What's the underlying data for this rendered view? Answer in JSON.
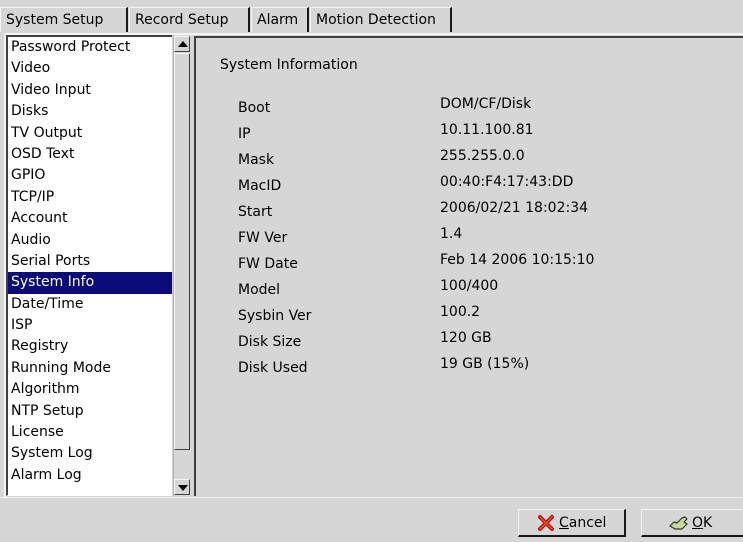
{
  "tabs": [
    {
      "label": "System Setup",
      "active": true
    },
    {
      "label": "Record Setup",
      "active": false
    },
    {
      "label": "Alarm",
      "active": false
    },
    {
      "label": "Motion Detection",
      "active": false
    }
  ],
  "sidebar": {
    "items": [
      "Password Protect",
      "Video",
      "Video Input",
      "Disks",
      "TV Output",
      "OSD Text",
      "GPIO",
      "TCP/IP",
      "Account",
      "Audio",
      "Serial Ports",
      "System Info",
      "Date/Time",
      "ISP",
      "Registry",
      "Running Mode",
      "Algorithm",
      "NTP Setup",
      "License",
      "System Log",
      "Alarm Log"
    ],
    "selected": "System Info"
  },
  "panel": {
    "title": "System Information",
    "rows": [
      {
        "label": "Boot",
        "value": "DOM/CF/Disk"
      },
      {
        "label": "IP",
        "value": "10.11.100.81"
      },
      {
        "label": "Mask",
        "value": "255.255.0.0"
      },
      {
        "label": "MacID",
        "value": "00:40:F4:17:43:DD"
      },
      {
        "label": "Start",
        "value": "2006/02/21 18:02:34"
      },
      {
        "label": "FW Ver",
        "value": "1.4"
      },
      {
        "label": "FW Date",
        "value": "Feb 14 2006 10:15:10"
      },
      {
        "label": "Model",
        "value": "100/400"
      },
      {
        "label": "Sysbin Ver",
        "value": "100.2"
      },
      {
        "label": "Disk Size",
        "value": "120 GB"
      },
      {
        "label": "Disk Used",
        "value": "19 GB (15%)"
      }
    ]
  },
  "buttons": {
    "cancel_mnemonic": "C",
    "cancel_rest": "ancel",
    "ok_mnemonic": "O",
    "ok_rest": "K"
  },
  "colors": {
    "selection": "#0a0a7a",
    "background": "#d6d6d6"
  }
}
